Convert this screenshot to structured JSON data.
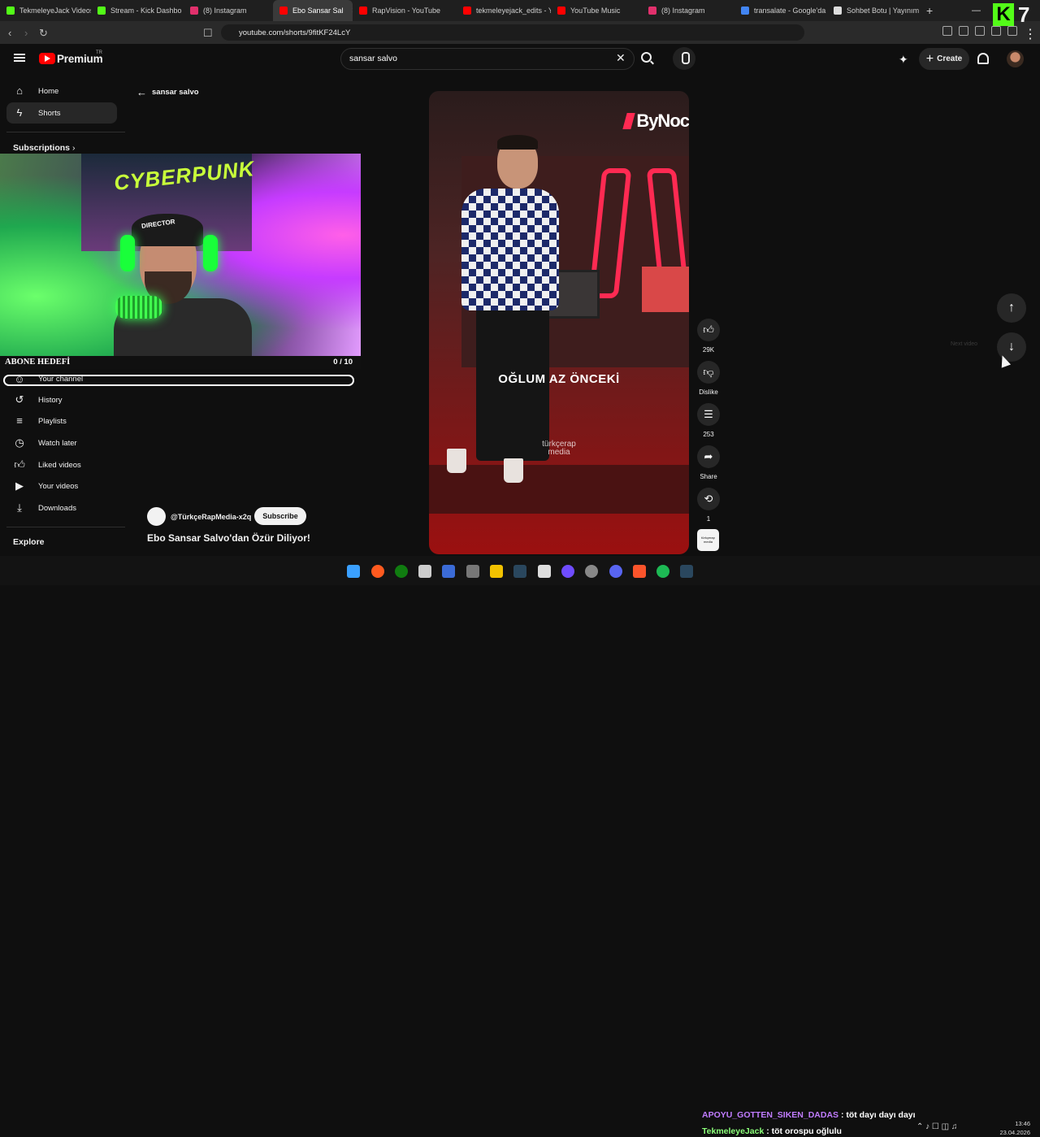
{
  "browser": {
    "tabs": [
      {
        "title": "TekmeleyeJack Videos",
        "color": "#53fc18",
        "active": false
      },
      {
        "title": "Stream - Kick Dashbo",
        "color": "#53fc18",
        "active": false
      },
      {
        "title": "(8) Instagram",
        "color": "#e1306c",
        "active": false
      },
      {
        "title": "Ebo Sansar Sal",
        "color": "#ff0000",
        "active": true
      },
      {
        "title": "RapVision - YouTube",
        "color": "#ff0000",
        "active": false
      },
      {
        "title": "tekmeleyejack_edits - Y",
        "color": "#ff0000",
        "active": false
      },
      {
        "title": "YouTube Music",
        "color": "#ff0000",
        "active": false
      },
      {
        "title": "(8) Instagram",
        "color": "#e1306c",
        "active": false
      },
      {
        "title": "transalate - Google'da",
        "color": "#4285f4",
        "active": false
      },
      {
        "title": "Sohbet Botu | Yayınım",
        "color": "#dddddd",
        "active": false
      }
    ],
    "new_tab": "+",
    "url": "youtube.com/shorts/9fitKF24LcY"
  },
  "header": {
    "brand": "Premium",
    "region": "TR",
    "search_value": "sansar salvo",
    "create_label": "Create",
    "overlay_k": "K",
    "overlay_number": "7"
  },
  "sidebar": {
    "home": "Home",
    "shorts": "Shorts",
    "subscriptions": "Subscriptions",
    "your_channel": "Your channel",
    "history": "History",
    "playlists": "Playlists",
    "watch_later": "Watch later",
    "liked": "Liked videos",
    "your_videos": "Your videos",
    "downloads": "Downloads",
    "explore": "Explore"
  },
  "webcam": {
    "poster_text": "CYBERPUNK",
    "cap_text": "DIRECTOR",
    "goal_label": "ABONE HEDEFİ",
    "goal_count": "0 / 10"
  },
  "short": {
    "back_label": "sansar salvo",
    "corner_logo": "ByNoc",
    "overlay_caption": "OĞLUM AZ ÖNCEKİ",
    "watermark_1": "türkçerap",
    "watermark_2": "media",
    "likes": "29K",
    "dislike_label": "Dislike",
    "comments": "253",
    "share_label": "Share",
    "remix_count": "1",
    "channel_thumb_text": "türkçerap media",
    "channel_name": "@TürkçeRapMedia-x2q",
    "subscribe_label": "Subscribe",
    "title": "Ebo Sansar Salvo'dan Özür Diliyor!",
    "next_tooltip": "Next video"
  },
  "chat": {
    "user1": "APOYU_GOTTEN_SIKEN_DADAS",
    "msg1": " : töt dayı dayı dayı",
    "user2": "TekmeleyeJack",
    "msg2": " : töt orospu oğlulu"
  },
  "system": {
    "time": "13:46",
    "date": "23.04.2026"
  }
}
